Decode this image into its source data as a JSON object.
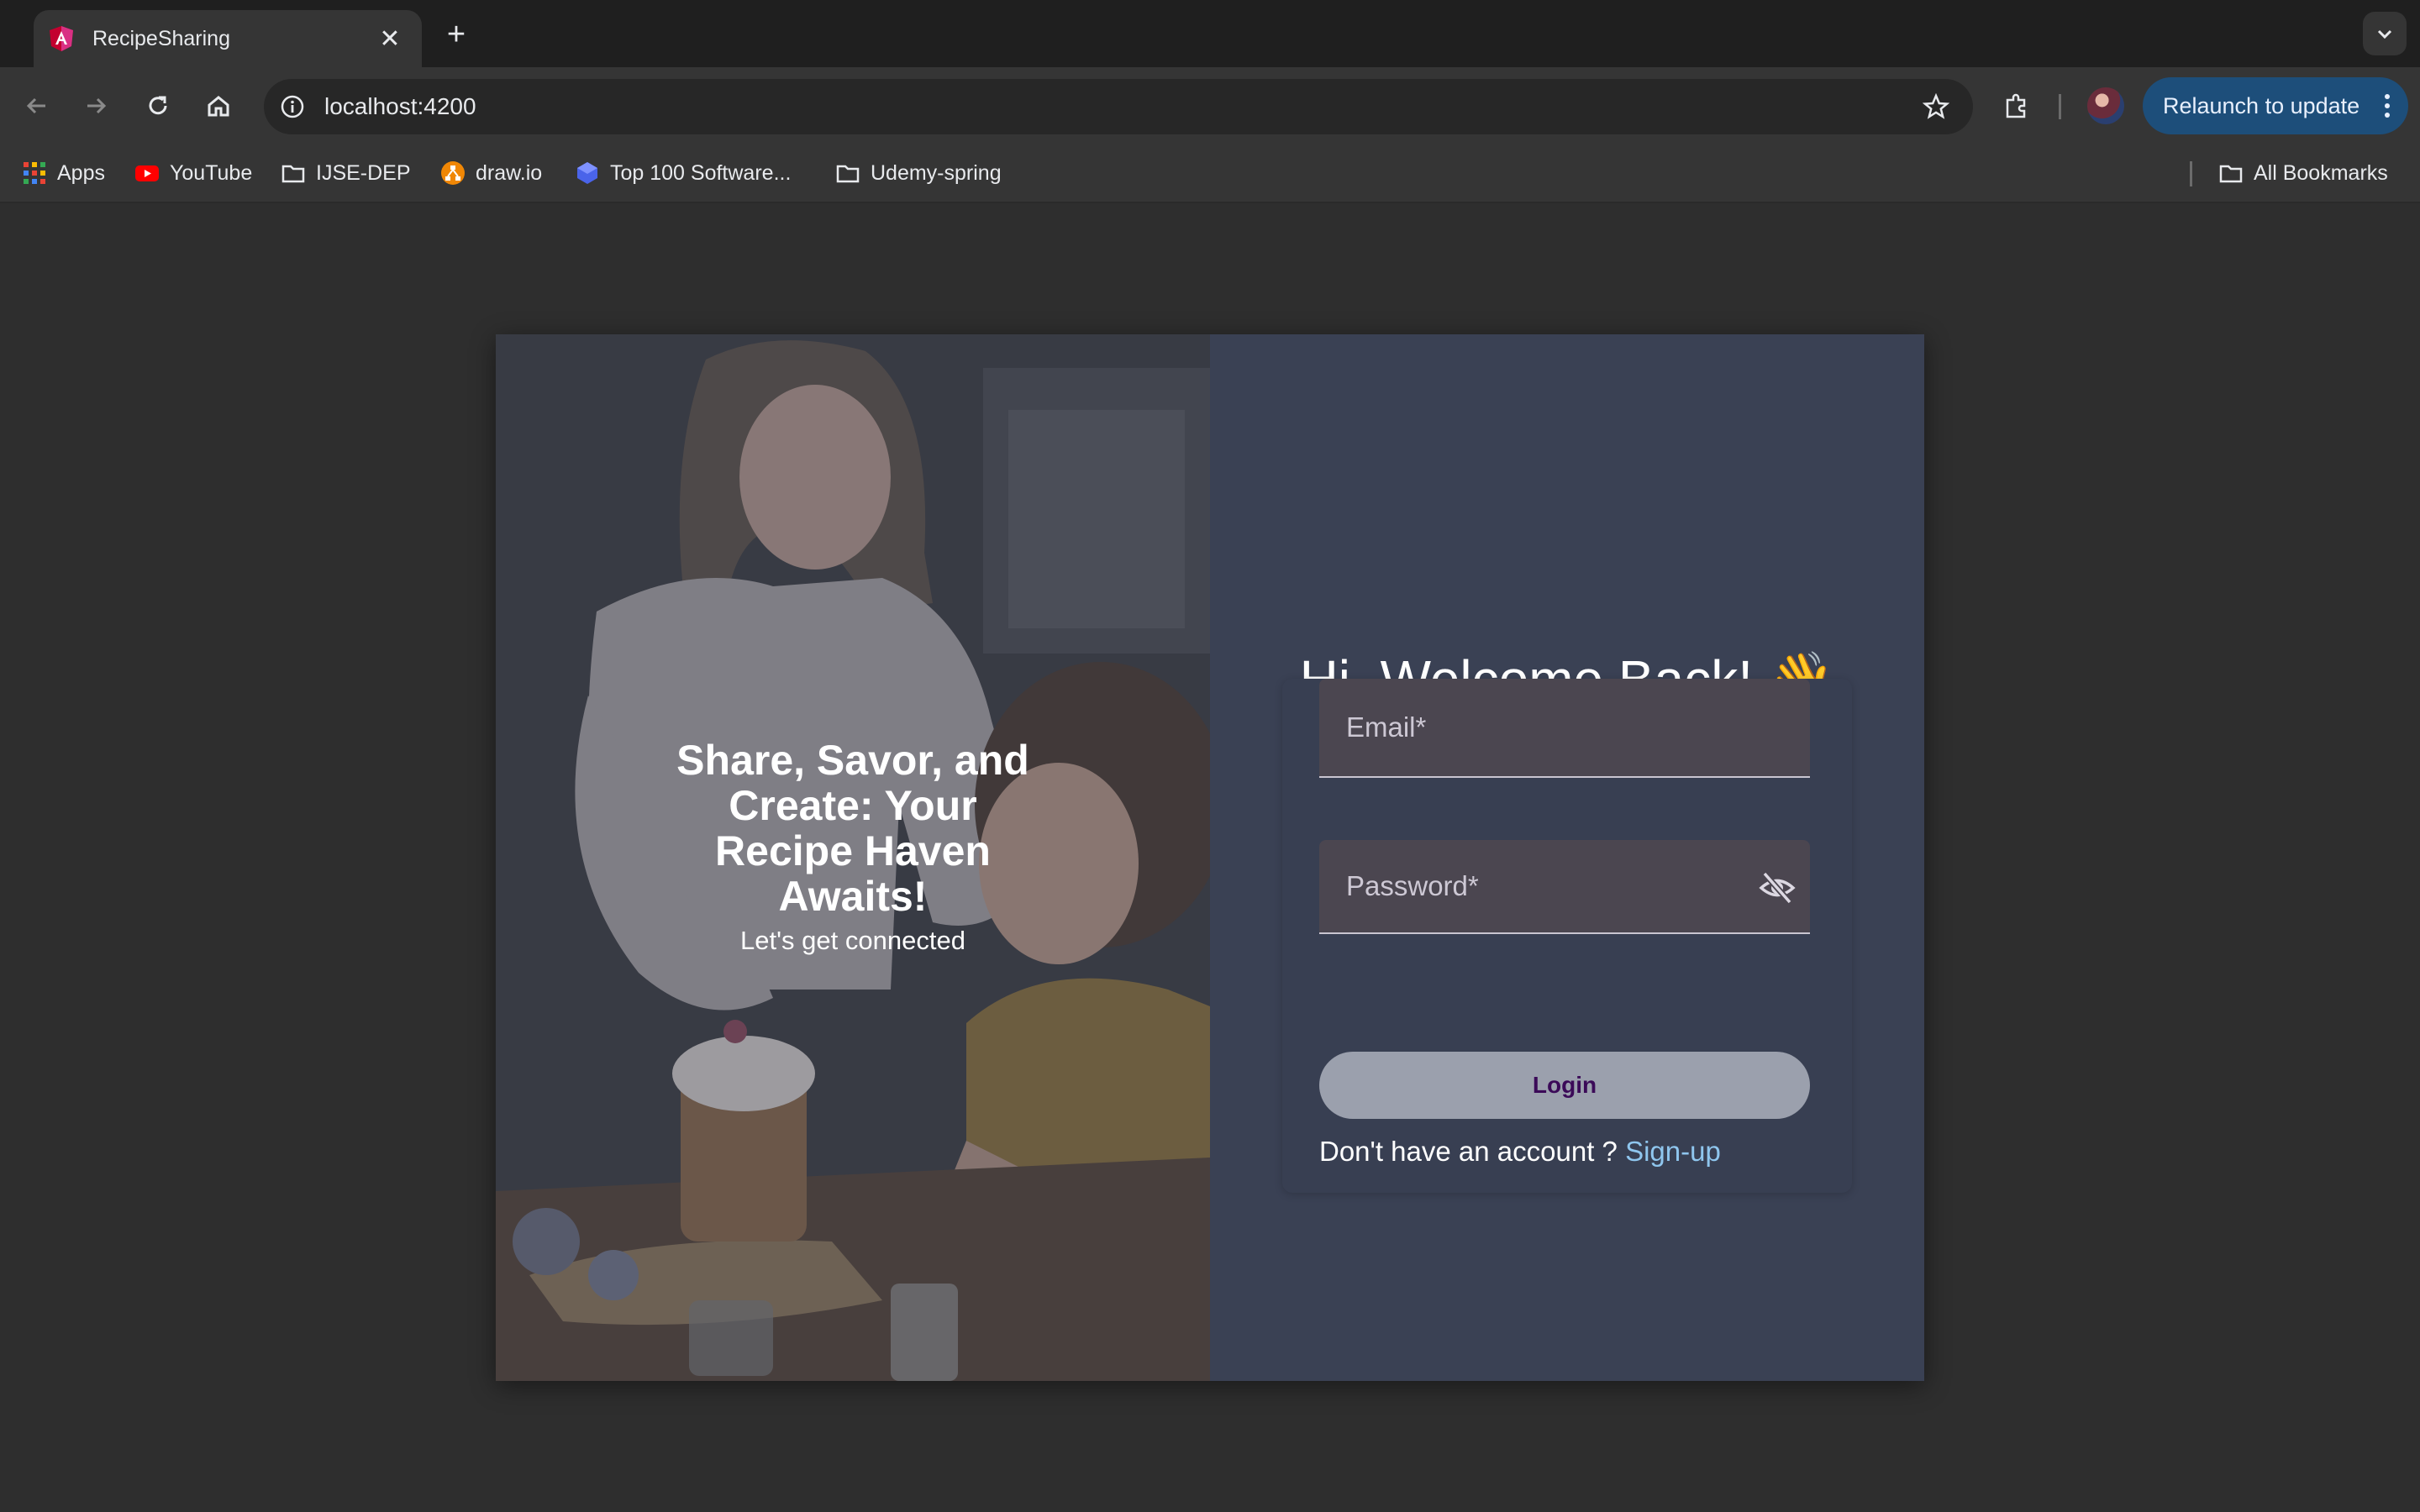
{
  "browser": {
    "tab": {
      "title": "RecipeSharing"
    },
    "address": {
      "url": "localhost:4200"
    },
    "relaunch_label": "Relaunch to update",
    "bookmarks": [
      {
        "label": "Apps",
        "icon": "apps-grid-icon"
      },
      {
        "label": "YouTube",
        "icon": "youtube-icon"
      },
      {
        "label": "IJSE-DEP",
        "icon": "folder-icon"
      },
      {
        "label": "draw.io",
        "icon": "drawio-icon"
      },
      {
        "label": "Top 100 Software...",
        "icon": "cube-icon"
      },
      {
        "label": "Udemy-spring",
        "icon": "folder-icon"
      }
    ],
    "all_bookmarks": "All Bookmarks"
  },
  "hero": {
    "title": "Share, Savor, and Create: Your Recipe Haven Awaits!",
    "subtitle": "Let's get connected"
  },
  "login": {
    "heading": "Hi, Welcome Back! 👋",
    "email_placeholder": "Email*",
    "password_placeholder": "Password*",
    "button_label": "Login",
    "signup_prompt": "Don't have an account ?",
    "signup_link": "Sign-up"
  },
  "colors": {
    "accent_link": "#8fc6ee",
    "relaunch_bg": "#1d4e7a",
    "form_panel": "#3a4154",
    "login_text": "#3b0a58"
  }
}
